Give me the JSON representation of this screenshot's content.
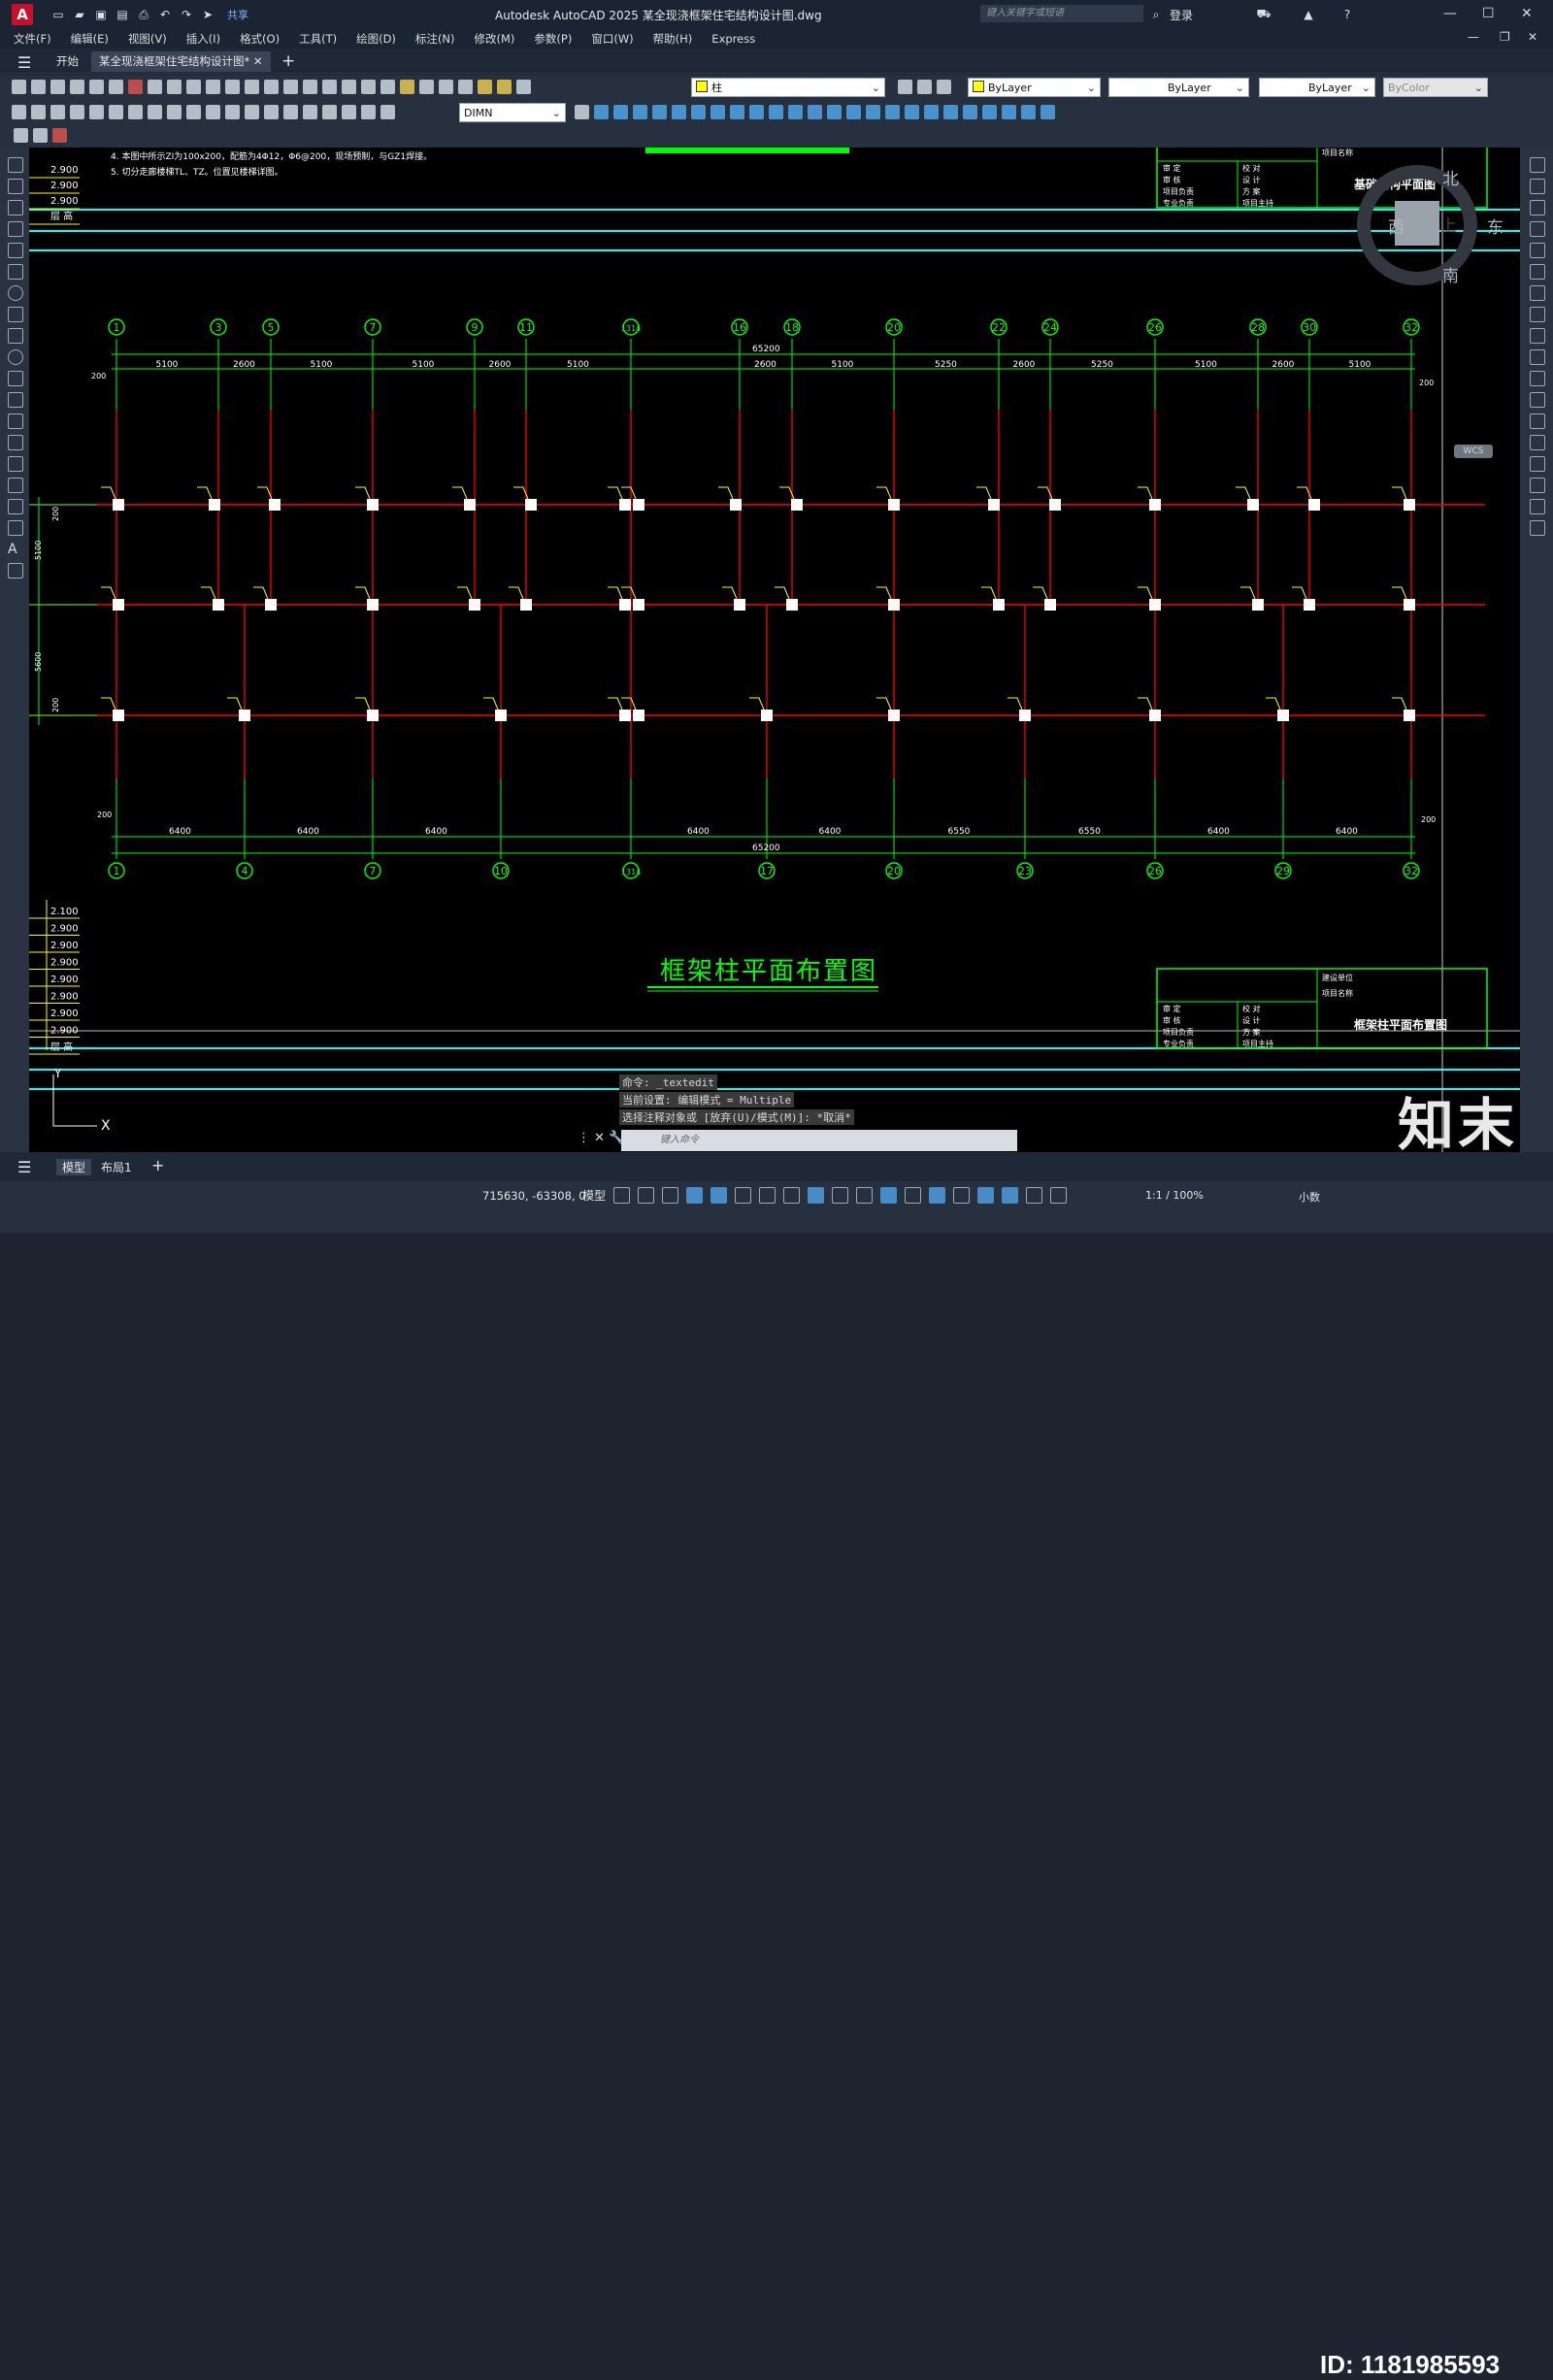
{
  "app": {
    "logo": "A",
    "title": "Autodesk AutoCAD 2025    某全现浇框架住宅结构设计图.dwg",
    "share": "共享",
    "search_placeholder": "键入关键字或短语",
    "login": "登录"
  },
  "menu": [
    "文件(F)",
    "编辑(E)",
    "视图(V)",
    "插入(I)",
    "格式(O)",
    "工具(T)",
    "绘图(D)",
    "标注(N)",
    "修改(M)",
    "参数(P)",
    "窗口(W)",
    "帮助(H)",
    "Express"
  ],
  "tabs": {
    "start": "开始",
    "doc": "某全现浇框架住宅结构设计图*"
  },
  "properties": {
    "layer": "柱",
    "color": "ByLayer",
    "linetype": "ByLayer",
    "lineweight": "ByLayer",
    "plotstyle": "ByColor",
    "dimstyle": "DIMN"
  },
  "drawing": {
    "notes": [
      "4. 本图中所示ZI为100x200，配筋为4Φ12，Φ6@200，现场预制，与GZ1焊接。",
      "5. 切分走廊楼梯TL、TZ。位置见楼梯详图。"
    ],
    "top_grids": [
      "1",
      "3",
      "5",
      "7",
      "9",
      "11",
      "1314",
      "16",
      "18",
      "20",
      "22",
      "24",
      "26",
      "28",
      "30",
      "32"
    ],
    "bottom_grids": [
      "1",
      "4",
      "7",
      "10",
      "1314",
      "17",
      "20",
      "23",
      "26",
      "29",
      "32"
    ],
    "top_total": "65200",
    "bottom_total": "65200",
    "top_dims": [
      "5100",
      "2600",
      "5100",
      "5100",
      "2600",
      "5100",
      "2600",
      "5100",
      "5250",
      "2600",
      "5250",
      "5100",
      "2600",
      "5100"
    ],
    "bottom_dims": [
      "6400",
      "6400",
      "6400",
      "6400",
      "6400",
      "6550",
      "6550",
      "6400",
      "6400"
    ],
    "side_dims": [
      "200",
      "5100",
      "5600",
      "200",
      "200",
      "200",
      "200",
      "200"
    ],
    "title": "框架柱平面布置图",
    "title_block_top": {
      "name": "基础结构平面图",
      "project": "项目名称",
      "rows": [
        "审 定",
        "审 核",
        "项目负责",
        "专业负责"
      ],
      "rows2": [
        "校 对",
        "设 计",
        "方 案",
        "项目主持"
      ]
    },
    "title_block_bottom": {
      "name": "框架柱平面布置图",
      "unit": "建设单位",
      "project": "项目名称",
      "rows": [
        "审 定",
        "审 核",
        "项目负责",
        "专业负责"
      ],
      "rows2": [
        "校 对",
        "设 计",
        "方 案",
        "项目主持"
      ]
    },
    "elev_top": [
      "2.900",
      "2.900",
      "2.900",
      "层  高"
    ],
    "elev_bottom": [
      "2.100",
      "2.900",
      "2.900",
      "2.900",
      "2.900",
      "2.900",
      "2.900",
      "2.900",
      "层  高"
    ],
    "compass": {
      "n": "北",
      "s": "南",
      "e": "东",
      "w": "西",
      "up": "上",
      "wcs": "WCS"
    },
    "ucs": {
      "x": "X",
      "y": "Y"
    }
  },
  "command": {
    "history": [
      "命令: _textedit",
      "当前设置: 编辑模式 = Multiple",
      "选择注释对象或 [放弃(U)/模式(M)]: *取消*"
    ],
    "placeholder": "键入命令"
  },
  "layouts": [
    "模型",
    "布局1"
  ],
  "status": {
    "coords": "715630, -63308, 0",
    "model": "模型",
    "scale": "1:1 / 100%",
    "units": "小数"
  },
  "watermark": {
    "logo": "知末",
    "id": "ID: 1181985593"
  },
  "colors": {
    "grid_green": "#00ff00",
    "beam_red": "#ff0000",
    "cyan": "#00ffff",
    "yellow": "#ffff00",
    "canvas": "#000000"
  }
}
